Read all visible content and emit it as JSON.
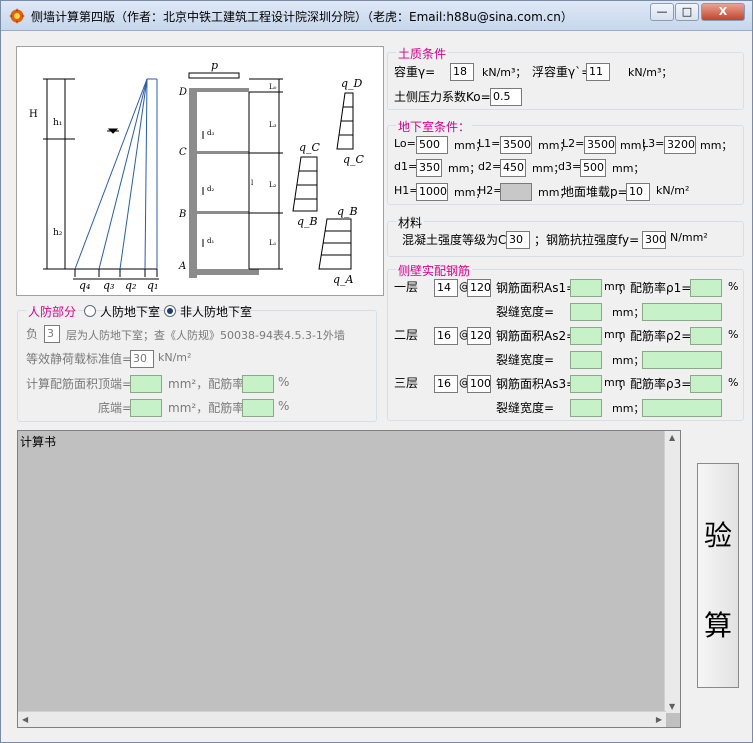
{
  "window": {
    "title": "侧墙计算第四版（作者：北京中铁工建筑工程设计院深圳分院）（老虎：Email:h88u@sina.com.cn）",
    "min_label": "—",
    "max_label": "□",
    "close_label": "X"
  },
  "diagram": {
    "p": "p",
    "D": "D",
    "C": "C",
    "B": "B",
    "A": "A",
    "H": "H",
    "h1": "h₁",
    "h2": "h₂",
    "q4": "q₄",
    "q3": "q₃",
    "q2": "q₂",
    "q1": "q₁",
    "qD": "q_D",
    "qC": "q_C",
    "qCb": "q_C",
    "qB": "q_B",
    "qBb": "q_B",
    "qA": "q_A",
    "L0": "L₀",
    "L1": "L₁",
    "L2": "L₂",
    "L3": "L₃",
    "d1": "d₁",
    "d2": "d₂",
    "d3": "d₃",
    "l": "l"
  },
  "soil": {
    "title": "土质条件",
    "unit_weight_label": "容重γ=",
    "unit_weight_value": "18",
    "unit_weight_unit": "kN/m³；",
    "buoyant_label": "浮容重γ`=",
    "buoyant_value": "11",
    "buoyant_unit": "kN/m³；",
    "k0_label": "土侧压力系数Ko=",
    "k0_value": "0.5"
  },
  "basement": {
    "title": "地下室条件：",
    "lo_label": "Lo=",
    "lo_value": "500",
    "l1_label": "L1=",
    "l1_value": "3500",
    "l2_label": "L2=",
    "l2_value": "3500",
    "l3_label": "L3=",
    "l3_value": "3200",
    "mm": "mm；",
    "d1_label": "d1=",
    "d1_value": "350",
    "d2_label": "d2=",
    "d2_value": "450",
    "d3_label": "d3=",
    "d3_value": "500",
    "h1_label": "H1=",
    "h1_value": "1000",
    "h2_label": "H2=",
    "h2_value": "",
    "surcharge_label": "地面堆载p=",
    "surcharge_value": "10",
    "surcharge_unit": "kN/m²"
  },
  "material": {
    "title": "材料",
    "concrete_label": "混凝土强度等级为C",
    "concrete_value": "30",
    "steel_label": "；钢筋抗拉强度fy=",
    "steel_value": "300",
    "steel_unit": "N/mm²"
  },
  "rebar": {
    "title": "侧壁实配钢筋",
    "floors": [
      {
        "label": "一层",
        "dia": "14",
        "spacing": "120",
        "area_label": "钢筋面积As1=",
        "ratio_label": "；配筋率ρ1="
      },
      {
        "label": "二层",
        "dia": "16",
        "spacing": "120",
        "area_label": "钢筋面积As2=",
        "ratio_label": "；配筋率ρ2="
      },
      {
        "label": "三层",
        "dia": "16",
        "spacing": "100",
        "area_label": "钢筋面积As3=",
        "ratio_label": "；配筋率ρ3="
      }
    ],
    "at": "@",
    "mm": "mm",
    "mm_semi": "mm；",
    "percent": "%",
    "crack_label": "裂缝宽度="
  },
  "civil_defense": {
    "title": "人防部分",
    "option_civil": "人防地下室",
    "option_noncivil": "非人防地下室",
    "selected": "非人防地下室",
    "floor_prefix": "负",
    "floor_value": "3",
    "floor_text": "层为人防地下室；查《人防规》50038-94表4.5.3-1外墙",
    "equiv_label": "等效静荷载标准值=",
    "equiv_value": "30",
    "equiv_unit": "kN/m²",
    "top_label": "计算配筋面积顶端=",
    "area_unit": "mm²，配筋率=",
    "percent": "%",
    "bottom_label": "底端="
  },
  "calc": {
    "title": "计算书"
  },
  "verify": {
    "label1": "验",
    "label2": "算"
  }
}
